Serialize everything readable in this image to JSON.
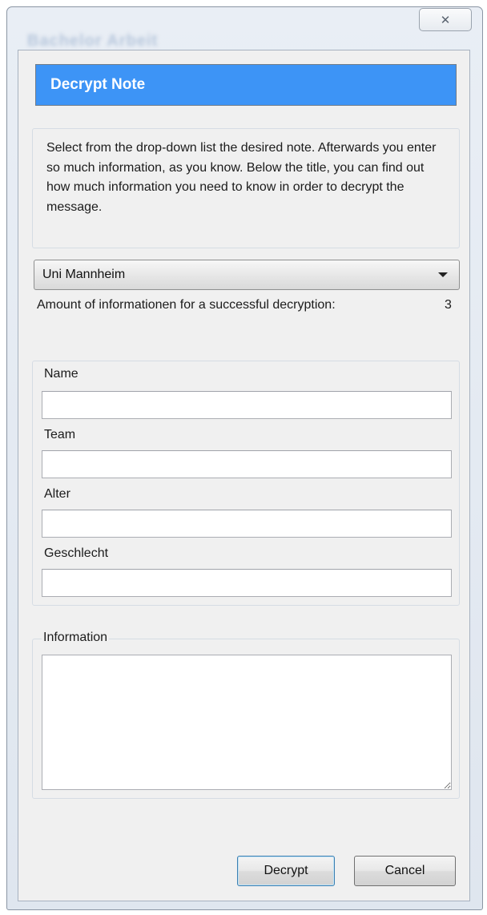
{
  "window": {
    "close_glyph": "✕",
    "background_title": "Bachelor Arbeit"
  },
  "header": {
    "title": "Decrypt Note",
    "color": "#3d94f6"
  },
  "instructions": {
    "text": "Select from the drop-down list the desired note. Afterwards you enter so much information, as you know. Below the title, you can find out how much information you need to know in order to decrypt the message."
  },
  "note_select": {
    "selected": "Uni Mannheim"
  },
  "amount": {
    "label": "Amount of informationen for a successful decryption:",
    "value": "3"
  },
  "fields": [
    {
      "label": "Name",
      "value": ""
    },
    {
      "label": "Team",
      "value": ""
    },
    {
      "label": "Alter",
      "value": ""
    },
    {
      "label": "Geschlecht",
      "value": ""
    }
  ],
  "information": {
    "legend": "Information",
    "value": ""
  },
  "buttons": {
    "decrypt": "Decrypt",
    "cancel": "Cancel"
  }
}
